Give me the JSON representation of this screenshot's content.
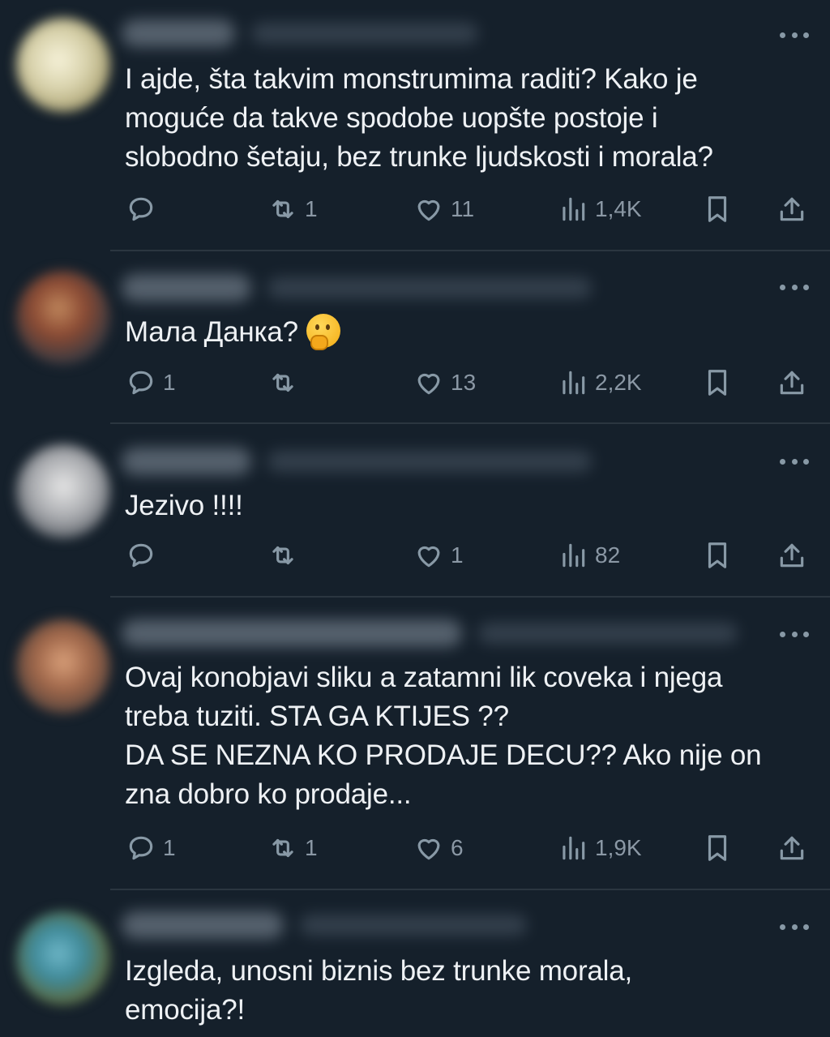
{
  "tweets": [
    {
      "text": "I ajde, šta takvim monstrumima raditi? Kako je\nmoguće da takve spodobe uopšte postoje i\nslobodno šetaju, bez trunke ljudskosti i morala?",
      "replies": "",
      "retweets": "1",
      "likes": "11",
      "views": "1,4K"
    },
    {
      "text": "Мала Данка?",
      "emoji": "thinking-face",
      "replies": "1",
      "retweets": "",
      "likes": "13",
      "views": "2,2K"
    },
    {
      "text": "Jezivo !!!!",
      "replies": "",
      "retweets": "",
      "likes": "1",
      "views": "82"
    },
    {
      "text": "Ovaj konobjavi sliku a zatamni lik coveka i njega\ntreba tuziti. STA GA KTIJES ??\nDA SE NEZNA KO PRODAJE DECU?? Ako nije on\nzna dobro ko prodaje...",
      "replies": "1",
      "retweets": "1",
      "likes": "6",
      "views": "1,9K"
    },
    {
      "text": "Izgleda, unosni biznis bez trunke morala,\nemocija?!"
    }
  ],
  "colors": {
    "background": "#15202b",
    "text": "#eef1f4",
    "icon": "#8899a6",
    "divider": "#2b3640"
  },
  "icons": [
    "reply-icon",
    "retweet-icon",
    "like-icon",
    "views-icon",
    "bookmark-icon",
    "share-icon",
    "more-icon"
  ]
}
